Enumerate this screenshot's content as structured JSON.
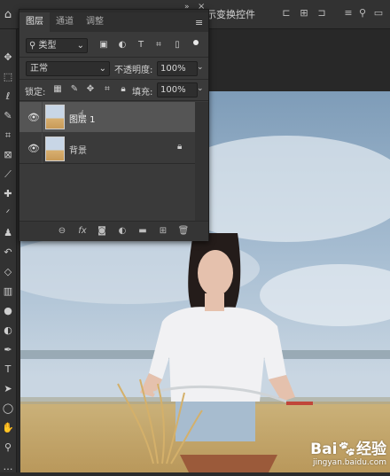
{
  "topbar": {
    "transform_label": "示变换控件"
  },
  "panel": {
    "tabs": [
      {
        "label": "图层"
      },
      {
        "label": "通道"
      },
      {
        "label": "调整"
      }
    ],
    "filter": {
      "label": "类型"
    },
    "blend_mode": "正常",
    "opacity": {
      "label": "不透明度:",
      "value": "100%"
    },
    "lock": {
      "label": "锁定:"
    },
    "fill": {
      "label": "填充:",
      "value": "100%"
    },
    "layers": [
      {
        "name": "图层 1",
        "selected": true,
        "visible": true
      },
      {
        "name": "背景",
        "selected": false,
        "visible": true,
        "locked": true
      }
    ]
  },
  "watermark": {
    "brand_left": "Bai",
    "brand_right": "经验",
    "url": "jingyan.baidu.com"
  }
}
